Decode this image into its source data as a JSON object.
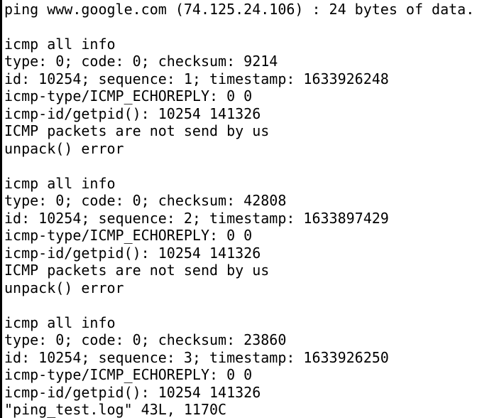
{
  "terminal": {
    "lines": [
      "ping www.google.com (74.125.24.106) : 24 bytes of data.",
      "",
      "icmp all info",
      "type: 0; code: 0; checksum: 9214",
      "id: 10254; sequence: 1; timestamp: 1633926248",
      "icmp-type/ICMP_ECHOREPLY: 0 0",
      "icmp-id/getpid(): 10254 141326",
      "ICMP packets are not send by us",
      "unpack() error",
      "",
      "icmp all info",
      "type: 0; code: 0; checksum: 42808",
      "id: 10254; sequence: 2; timestamp: 1633897429",
      "icmp-type/ICMP_ECHOREPLY: 0 0",
      "icmp-id/getpid(): 10254 141326",
      "ICMP packets are not send by us",
      "unpack() error",
      "",
      "icmp all info",
      "type: 0; code: 0; checksum: 23860",
      "id: 10254; sequence: 3; timestamp: 1633926250",
      "icmp-type/ICMP_ECHOREPLY: 0 0",
      "icmp-id/getpid(): 10254 141326"
    ],
    "status_line": "\"ping_test.log\" 43L, 1170C"
  }
}
